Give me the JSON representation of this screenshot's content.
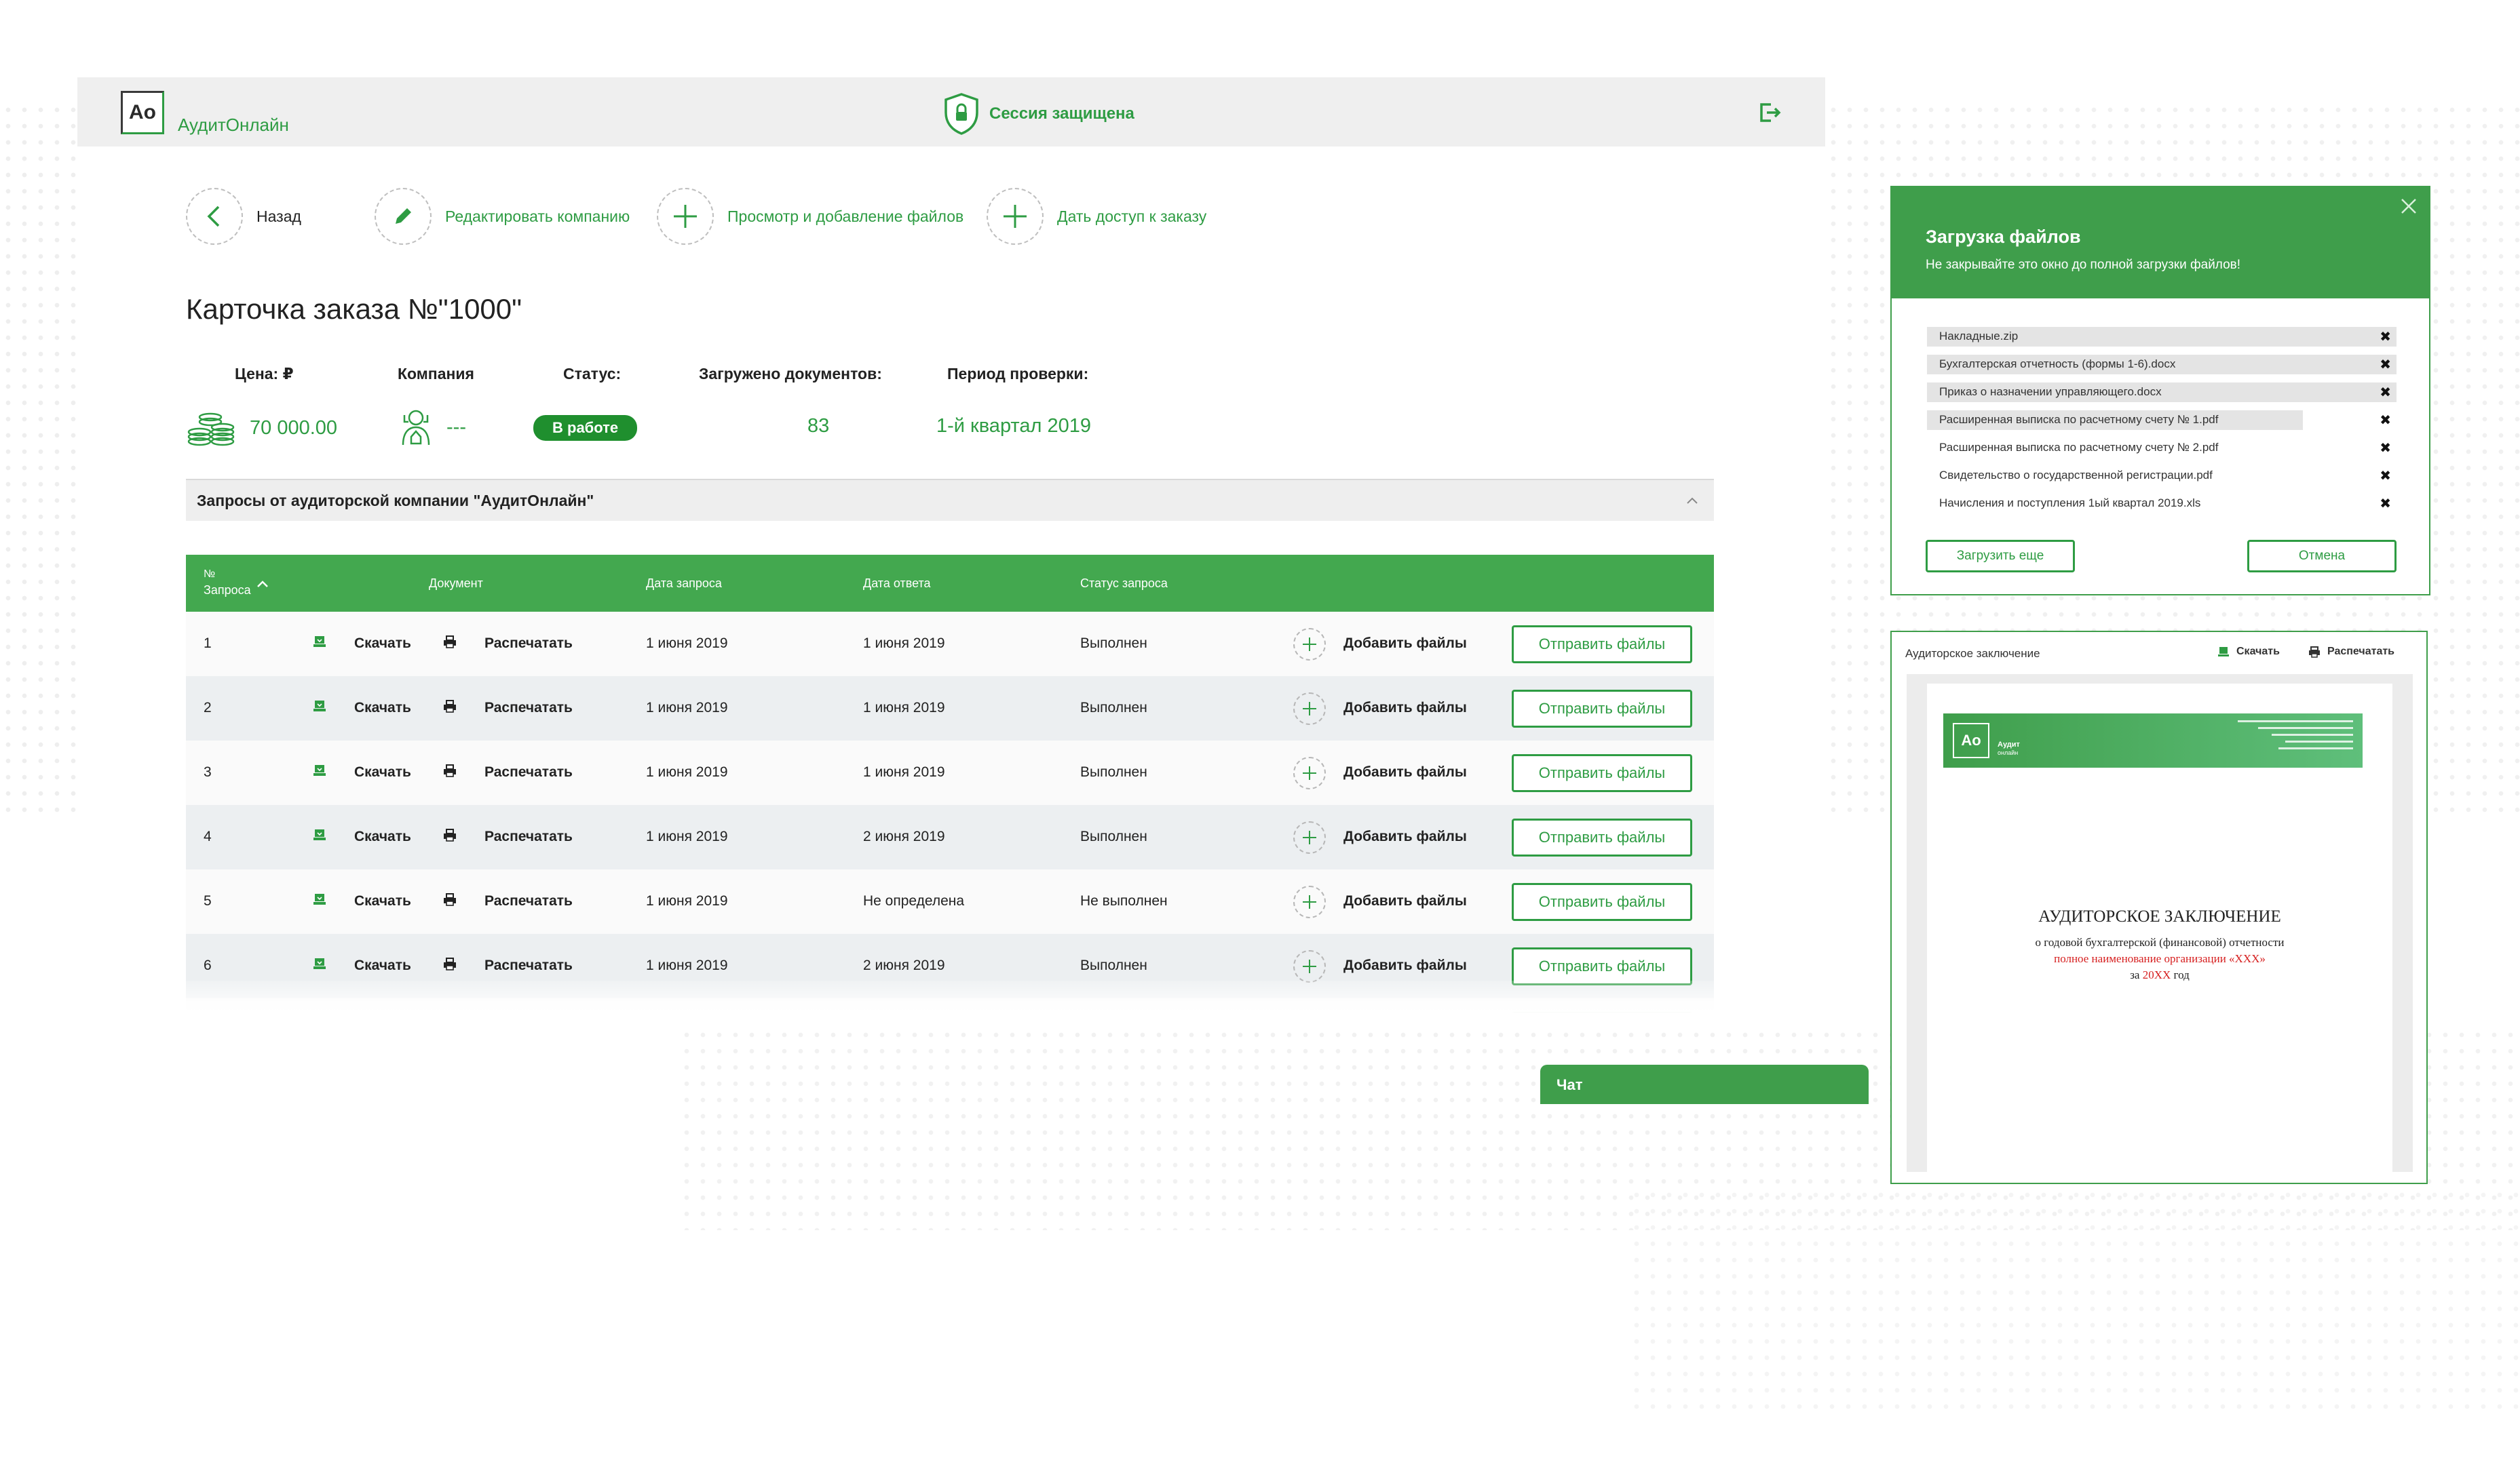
{
  "colors": {
    "brand_green": "#2e9c43",
    "header_green": "#43a84f",
    "badge_green": "#1f8f2e",
    "text": "#222222"
  },
  "header": {
    "logo_mark": "Ao",
    "logo_text": "АудитОнлайн",
    "session_text": "Сессия защищена",
    "session_icon": "shield-lock-icon",
    "logout_icon": "logout-icon"
  },
  "actions": {
    "back": "Назад",
    "edit_company": "Редактировать компанию",
    "files": "Просмотр и добавление файлов",
    "share": "Дать доступ к заказу"
  },
  "order": {
    "title": "Карточка заказа №\"1000\"",
    "summary": {
      "price_label": "Цена: ₽",
      "price_value": "70 000.00",
      "company_label": "Компания",
      "company_value": "---",
      "status_label": "Статус:",
      "status_value": "В работе",
      "docs_label": "Загружено документов:",
      "docs_value": "83",
      "period_label": "Период проверки:",
      "period_value": "1-й квартал 2019"
    }
  },
  "requests": {
    "section_title": "Запросы от аудиторской компании \"АудитОнлайн\"",
    "columns": {
      "num_line1": "№",
      "num_line2": "Запроса",
      "document": "Документ",
      "request_date": "Дата запроса",
      "answer_date": "Дата ответа",
      "status": "Статус запроса"
    },
    "download_label": "Скачать",
    "print_label": "Распечатать",
    "add_files_label": "Добавить файлы",
    "send_files_label": "Отправить файлы",
    "rows": [
      {
        "num": "1",
        "request_date": "1 июня 2019",
        "answer_date": "1 июня 2019",
        "status": "Выполнен"
      },
      {
        "num": "2",
        "request_date": "1 июня 2019",
        "answer_date": "1 июня 2019",
        "status": "Выполнен"
      },
      {
        "num": "3",
        "request_date": "1 июня 2019",
        "answer_date": "1 июня 2019",
        "status": "Выполнен"
      },
      {
        "num": "4",
        "request_date": "1 июня 2019",
        "answer_date": "2 июня 2019",
        "status": "Выполнен"
      },
      {
        "num": "5",
        "request_date": "1 июня 2019",
        "answer_date": "Не определена",
        "status": "Не выполнен"
      },
      {
        "num": "6",
        "request_date": "1 июня 2019",
        "answer_date": "2 июня 2019",
        "status": "Выполнен"
      }
    ]
  },
  "chat": {
    "label": "Чат"
  },
  "upload_modal": {
    "title": "Загрузка файлов",
    "subtitle": "Не закрывайте это окно до полной загрузки файлов!",
    "files": [
      {
        "name": "Накладные.zip",
        "progress": 1.0
      },
      {
        "name": "Бухгалтерская отчетность (формы 1-6).docx",
        "progress": 1.0
      },
      {
        "name": "Приказ о назначении управляющего.docx",
        "progress": 1.0
      },
      {
        "name": "Расширенная выписка по расчетному счету № 1.pdf",
        "progress": 0.8
      },
      {
        "name": "Расширенная выписка по расчетному счету № 2.pdf",
        "progress": 0
      },
      {
        "name": "Свидетельство о государственной регистрации.pdf",
        "progress": 0
      },
      {
        "name": "Начисления и поступления 1ый квартал 2019.xls",
        "progress": 0
      }
    ],
    "remove_symbol": "✖",
    "upload_more": "Загрузить еще",
    "cancel": "Отмена"
  },
  "preview": {
    "title": "Аудиторское заключение",
    "download": "Скачать",
    "print": "Распечатать",
    "doc": {
      "logo_mark": "Ao",
      "logo_line1": "Аудит",
      "logo_line2": "онлайн",
      "heading": "АУДИТОРСКОЕ ЗАКЛЮЧЕНИЕ",
      "line1": "о годовой бухгалтерской (финансовой) отчетности",
      "line2": "полное наименование организации «ХХХ»",
      "line3_prefix": "за ",
      "line3_year": "20ХХ",
      "line3_suffix": " год"
    }
  }
}
